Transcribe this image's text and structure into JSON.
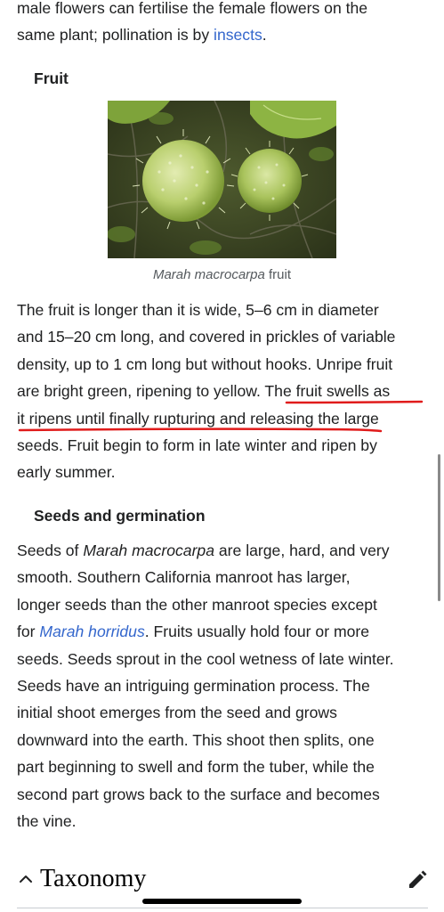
{
  "intro": {
    "line1": "male flowers can fertilise the female flowers on the",
    "line2_prefix": "same plant; pollination is by ",
    "line2_link": "insects",
    "line2_suffix": "."
  },
  "fruit": {
    "heading": "Fruit",
    "caption_italic": "Marah macrocarpa",
    "caption_rest": " fruit",
    "lines": [
      "The fruit is longer than it is wide, 5–6 cm in diameter",
      "and 15–20 cm long, and covered in prickles of variable",
      "density, up to 1 cm long but without hooks. Unripe fruit",
      "are bright green, ripening to yellow. The fruit swells as",
      "it ripens until finally rupturing and releasing the large",
      "seeds. Fruit begin to form in late winter and ripen by",
      "early summer."
    ]
  },
  "seeds": {
    "heading": "Seeds and germination",
    "line1_prefix": "Seeds of ",
    "line1_italic": "Marah macrocarpa",
    "line1_suffix": " are large, hard, and very",
    "line2": "smooth. Southern California manroot has larger,",
    "line3": "longer seeds than the other manroot species except",
    "line4_prefix": "for ",
    "line4_link": "Marah horridus",
    "line4_suffix": ". Fruits usually hold four or more",
    "lines_rest": [
      "seeds. Seeds sprout in the cool wetness of late winter.",
      "Seeds have an intriguing germination process. The",
      "initial shoot emerges from the seed and grows",
      "downward into the earth. This shoot then splits, one",
      "part beginning to swell and form the tuber, while the",
      "second part grows back to the surface and becomes",
      "the vine."
    ]
  },
  "section": {
    "title": "Taxonomy",
    "collapse_icon": "chevron-up-icon",
    "edit_icon": "pencil-icon"
  },
  "colors": {
    "link": "#3366cc",
    "annotation": "#e01b1b",
    "text": "#202122"
  }
}
